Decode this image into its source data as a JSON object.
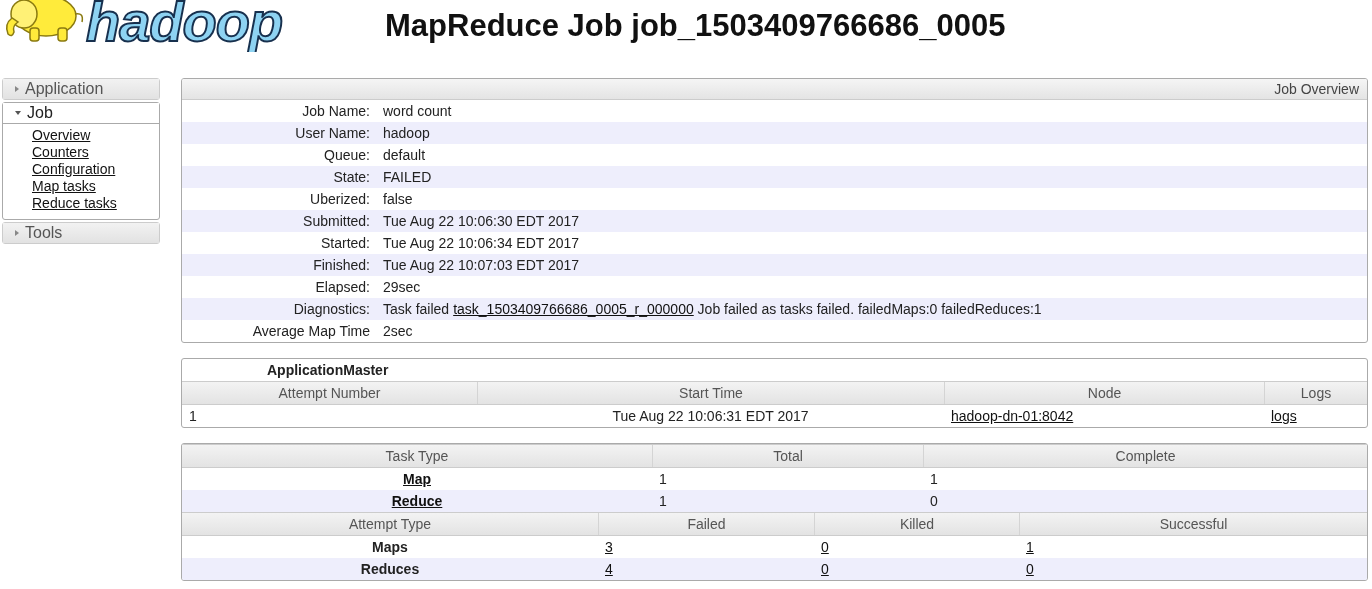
{
  "logo": {
    "text": "hadoop"
  },
  "title": "MapReduce Job job_1503409766686_0005",
  "sidebar": [
    {
      "label": "Application",
      "expanded": false
    },
    {
      "label": "Job",
      "expanded": true,
      "children": [
        "Overview",
        "Counters",
        "Configuration",
        "Map tasks",
        "Reduce tasks"
      ]
    },
    {
      "label": "Tools",
      "expanded": false
    }
  ],
  "overview": {
    "title": "Job Overview",
    "rows": [
      {
        "label": "Job Name:",
        "value": "word count"
      },
      {
        "label": "User Name:",
        "value": "hadoop"
      },
      {
        "label": "Queue:",
        "value": "default"
      },
      {
        "label": "State:",
        "value": "FAILED"
      },
      {
        "label": "Uberized:",
        "value": "false"
      },
      {
        "label": "Submitted:",
        "value": "Tue Aug 22 10:06:30 EDT 2017"
      },
      {
        "label": "Started:",
        "value": "Tue Aug 22 10:06:34 EDT 2017"
      },
      {
        "label": "Finished:",
        "value": "Tue Aug 22 10:07:03 EDT 2017"
      },
      {
        "label": "Elapsed:",
        "value": "29sec"
      },
      {
        "label": "Diagnostics:",
        "value": "Task failed",
        "link": "task_1503409766686_0005_r_000000",
        "value_after": "Job failed as tasks failed. failedMaps:0 failedReduces:1"
      },
      {
        "label": "Average Map Time",
        "value": "2sec"
      }
    ]
  },
  "app_master": {
    "caption": "ApplicationMaster",
    "columns": [
      "Attempt Number",
      "Start Time",
      "Node",
      "Logs"
    ],
    "rows": [
      {
        "attempt": "1",
        "start_time": "Tue Aug 22 10:06:31 EDT 2017",
        "node": "hadoop-dn-01:8042",
        "logs": "logs"
      }
    ]
  },
  "tasks": {
    "columns": [
      "Task Type",
      "Total",
      "Complete"
    ],
    "rows": [
      {
        "type": "Map",
        "total": "1",
        "complete": "1"
      },
      {
        "type": "Reduce",
        "total": "1",
        "complete": "0"
      }
    ],
    "attempt_columns": [
      "Attempt Type",
      "Failed",
      "Killed",
      "Successful"
    ],
    "attempt_rows": [
      {
        "type": "Maps",
        "failed": "3",
        "killed": "0",
        "successful": "1"
      },
      {
        "type": "Reduces",
        "failed": "4",
        "killed": "0",
        "successful": "0"
      }
    ]
  }
}
